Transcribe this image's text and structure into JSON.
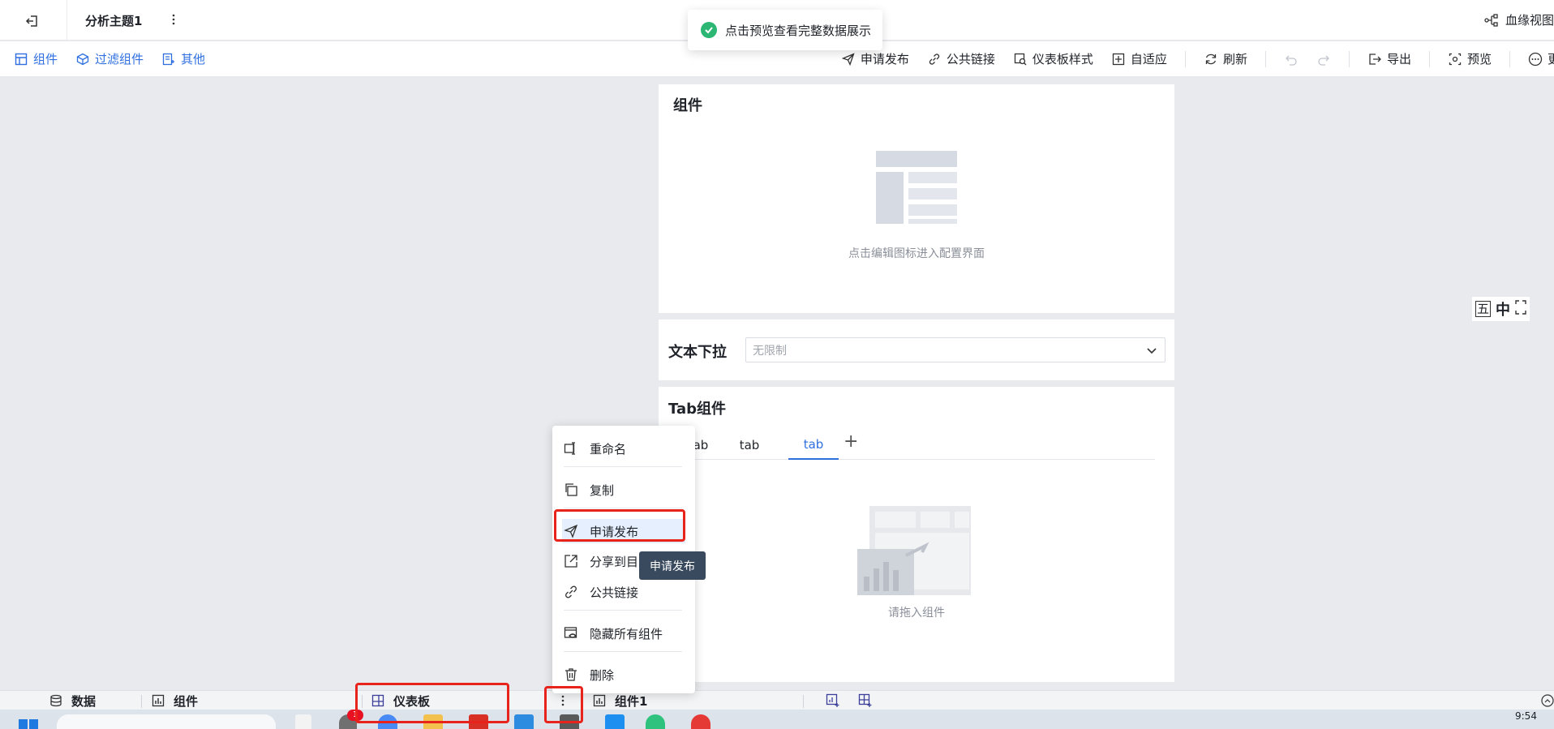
{
  "header": {
    "title": "分析主题1",
    "lineage_label": "血缘视图"
  },
  "toast": {
    "message": "点击预览查看完整数据展示"
  },
  "toolbar": {
    "left": [
      {
        "label": "组件",
        "icon": "component-icon"
      },
      {
        "label": "过滤组件",
        "icon": "filter-component-icon"
      },
      {
        "label": "其他",
        "icon": "other-icon"
      }
    ],
    "right": {
      "publish": "申请发布",
      "public_link": "公共链接",
      "dashboard_style": "仪表板样式",
      "adaptive": "自适应",
      "refresh": "刷新",
      "export": "导出",
      "preview": "预览",
      "more": "更多"
    }
  },
  "canvas": {
    "component_card": {
      "title": "组件",
      "hint": "点击编辑图标进入配置界面"
    },
    "dropdown_card": {
      "title": "文本下拉",
      "placeholder": "无限制"
    },
    "tab_card": {
      "title": "Tab组件",
      "tabs": [
        "tab",
        "tab",
        "tab"
      ],
      "active_tab": 2,
      "add_label": "+",
      "hint": "请拖入组件"
    }
  },
  "float_icons": [
    "五",
    "中"
  ],
  "context_menu": {
    "items": [
      {
        "label": "重命名",
        "icon": "rename-icon"
      },
      {
        "label": "复制",
        "icon": "copy-icon"
      },
      {
        "label": "申请发布",
        "icon": "send-icon"
      },
      {
        "label": "分享到目录",
        "icon": "share-icon"
      },
      {
        "label": "公共链接",
        "icon": "link-icon"
      },
      {
        "label": "隐藏所有组件",
        "icon": "hide-icon"
      },
      {
        "label": "删除",
        "icon": "trash-icon"
      }
    ],
    "tooltip": "申请发布"
  },
  "bottom_tabs": {
    "data": "数据",
    "component": "组件",
    "dashboard": "仪表板",
    "component1": "组件1"
  },
  "taskbar": {
    "badge": "1",
    "time": "9:54"
  },
  "colors": {
    "accent": "#2f6fe0",
    "highlight": "#e8231b",
    "success": "#2bb673"
  }
}
